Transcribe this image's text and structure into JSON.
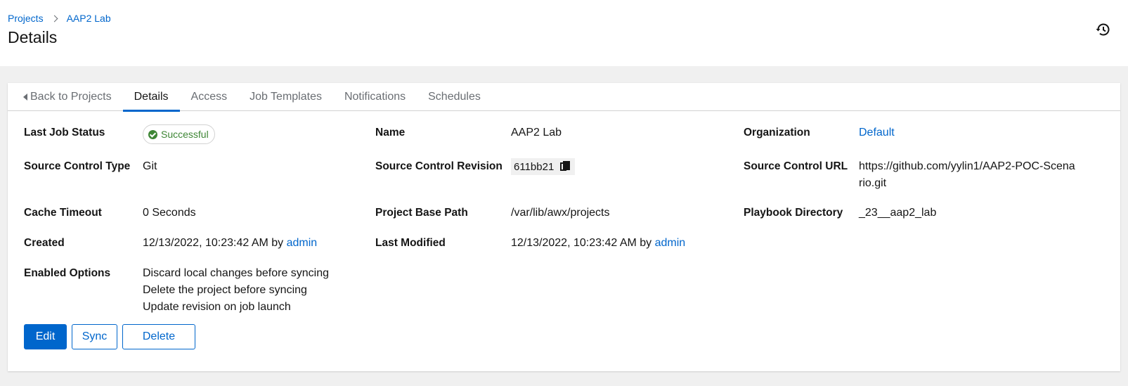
{
  "breadcrumb": {
    "projects": "Projects",
    "current": "AAP2 Lab"
  },
  "page_title": "Details",
  "icons": {
    "history": "history-icon",
    "copy": "copy-icon",
    "status": "check-circle-icon",
    "back": "caret-left-icon"
  },
  "colors": {
    "accent": "#0066cc",
    "success": "#3e8635"
  },
  "tabs": [
    {
      "label": "Back to Projects"
    },
    {
      "label": "Details"
    },
    {
      "label": "Access"
    },
    {
      "label": "Job Templates"
    },
    {
      "label": "Notifications"
    },
    {
      "label": "Schedules"
    }
  ],
  "active_tab": "Details",
  "details": {
    "last_job_status": {
      "label": "Last Job Status",
      "value": "Successful"
    },
    "name": {
      "label": "Name",
      "value": "AAP2 Lab"
    },
    "organization": {
      "label": "Organization",
      "value": "Default"
    },
    "source_control_type": {
      "label": "Source Control Type",
      "value": "Git"
    },
    "source_control_revision": {
      "label": "Source Control Revision",
      "value": "611bb21"
    },
    "source_control_url": {
      "label": "Source Control URL",
      "line1": "https://github.com/yylin1/AAP2-POC-Scena",
      "line2": "rio.git"
    },
    "cache_timeout": {
      "label": "Cache Timeout",
      "value": "0 Seconds"
    },
    "project_base_path": {
      "label": "Project Base Path",
      "value": "/var/lib/awx/projects"
    },
    "playbook_directory": {
      "label": "Playbook Directory",
      "value": "_23__aap2_lab"
    },
    "created": {
      "label": "Created",
      "date": "12/13/2022, 10:23:42 AM by",
      "user": "admin"
    },
    "last_modified": {
      "label": "Last Modified",
      "date": "12/13/2022, 10:23:42 AM by",
      "user": "admin"
    },
    "enabled_options": {
      "label": "Enabled Options",
      "items": [
        "Discard local changes before syncing",
        "Delete the project before syncing",
        "Update revision on job launch"
      ]
    }
  },
  "buttons": {
    "edit": "Edit",
    "sync": "Sync",
    "delete": "Delete"
  }
}
